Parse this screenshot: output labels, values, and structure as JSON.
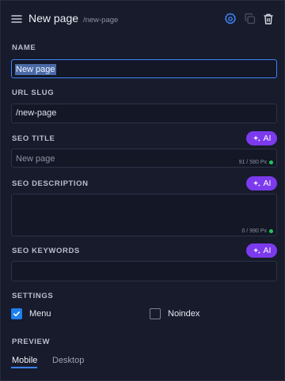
{
  "header": {
    "title": "New page",
    "slug": "/new-page",
    "icons": [
      "menu-icon",
      "settings-icon",
      "copy-icon",
      "trash-icon"
    ]
  },
  "fields": {
    "name": {
      "label": "NAME",
      "value": "New page"
    },
    "url_slug": {
      "label": "URL SLUG",
      "value": "/new-page"
    },
    "seo_title": {
      "label": "SEO TITLE",
      "placeholder": "New page",
      "counter": "91 / 580 Px"
    },
    "seo_description": {
      "label": "SEO DESCRIPTION",
      "value": "",
      "counter": "0 / 990 Px"
    },
    "seo_keywords": {
      "label": "SEO KEYWORDS",
      "value": ""
    }
  },
  "ai_button": {
    "label": "AI"
  },
  "settings": {
    "label": "SETTINGS",
    "options": [
      {
        "label": "Menu",
        "checked": true
      },
      {
        "label": "Noindex",
        "checked": false
      }
    ]
  },
  "preview": {
    "label": "PREVIEW",
    "tabs": [
      "Mobile",
      "Desktop"
    ],
    "active_tab": "Mobile"
  },
  "colors": {
    "accent": "#3f83f8",
    "ai": "#7c3aed",
    "counter_ok": "#22c55e",
    "background": "#171b2b"
  }
}
